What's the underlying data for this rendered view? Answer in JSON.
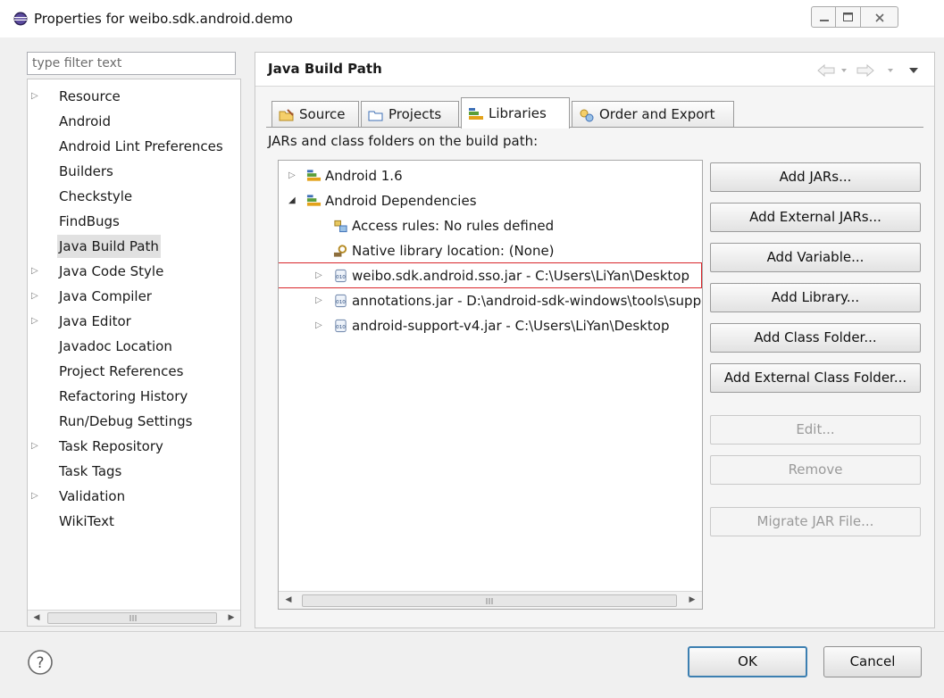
{
  "window": {
    "title": "Properties for weibo.sdk.android.demo",
    "icon": "eclipse-icon"
  },
  "nav": {
    "filter_placeholder": "type filter text",
    "items": [
      {
        "label": "Resource",
        "expandable": true
      },
      {
        "label": "Android",
        "expandable": false
      },
      {
        "label": "Android Lint Preferences",
        "expandable": false
      },
      {
        "label": "Builders",
        "expandable": false
      },
      {
        "label": "Checkstyle",
        "expandable": false
      },
      {
        "label": "FindBugs",
        "expandable": false
      },
      {
        "label": "Java Build Path",
        "expandable": false,
        "selected": true
      },
      {
        "label": "Java Code Style",
        "expandable": true
      },
      {
        "label": "Java Compiler",
        "expandable": true
      },
      {
        "label": "Java Editor",
        "expandable": true
      },
      {
        "label": "Javadoc Location",
        "expandable": false
      },
      {
        "label": "Project References",
        "expandable": false
      },
      {
        "label": "Refactoring History",
        "expandable": false
      },
      {
        "label": "Run/Debug Settings",
        "expandable": false
      },
      {
        "label": "Task Repository",
        "expandable": true
      },
      {
        "label": "Task Tags",
        "expandable": false
      },
      {
        "label": "Validation",
        "expandable": true
      },
      {
        "label": "WikiText",
        "expandable": false
      }
    ]
  },
  "panel": {
    "title": "Java Build Path",
    "tabs": [
      {
        "label": "Source",
        "icon": "source-folder-icon"
      },
      {
        "label": "Projects",
        "icon": "projects-folder-icon"
      },
      {
        "label": "Libraries",
        "icon": "libraries-icon",
        "active": true
      },
      {
        "label": "Order and Export",
        "icon": "order-export-icon"
      }
    ],
    "jars_label": "JARs and class folders on the build path:",
    "tree": [
      {
        "label": "Android 1.6",
        "icon": "library-icon",
        "state": "collapsed",
        "level": 0
      },
      {
        "label": "Android Dependencies",
        "icon": "library-icon",
        "state": "expanded",
        "level": 0
      },
      {
        "label": "Access rules: No rules defined",
        "icon": "access-rules-icon",
        "state": "leaf",
        "level": 1
      },
      {
        "label": "Native library location: (None)",
        "icon": "native-library-icon",
        "state": "leaf",
        "level": 1
      },
      {
        "label": "weibo.sdk.android.sso.jar - C:\\Users\\LiYan\\Desktop",
        "icon": "jar-icon",
        "state": "collapsed",
        "level": 1,
        "highlighted": true
      },
      {
        "label": "annotations.jar - D:\\android-sdk-windows\\tools\\support",
        "icon": "jar-icon",
        "state": "collapsed",
        "level": 1
      },
      {
        "label": "android-support-v4.jar - C:\\Users\\LiYan\\Desktop",
        "icon": "jar-icon",
        "state": "collapsed",
        "level": 1
      }
    ],
    "buttons": {
      "add_jars": "Add JARs...",
      "add_external_jars": "Add External JARs...",
      "add_variable": "Add Variable...",
      "add_library": "Add Library...",
      "add_class_folder": "Add Class Folder...",
      "add_external_class_folder": "Add External Class Folder...",
      "edit": "Edit...",
      "remove": "Remove",
      "migrate_jar": "Migrate JAR File..."
    }
  },
  "footer": {
    "ok": "OK",
    "cancel": "Cancel"
  },
  "colors": {
    "highlight_border": "#d9262b",
    "default_button_border": "#3c7fb1",
    "library_icon": "#e3a21a"
  }
}
